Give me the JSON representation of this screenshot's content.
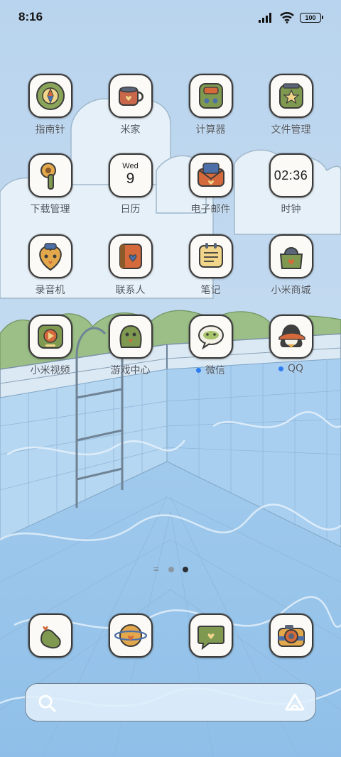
{
  "status_bar": {
    "time": "8:16",
    "battery": "100",
    "icons": [
      "signal-icon",
      "wifi-icon",
      "battery-icon"
    ]
  },
  "apps": [
    {
      "label": "指南针",
      "icon": "compass-icon"
    },
    {
      "label": "米家",
      "icon": "mijia-icon"
    },
    {
      "label": "计算器",
      "icon": "calculator-icon"
    },
    {
      "label": "文件管理",
      "icon": "file-manager-icon"
    },
    {
      "label": "下载管理",
      "icon": "download-icon"
    },
    {
      "label": "日历",
      "icon": "calendar-icon",
      "weekday": "Wed",
      "day": "9"
    },
    {
      "label": "电子邮件",
      "icon": "email-icon"
    },
    {
      "label": "时钟",
      "icon": "clock-icon",
      "time": "02:36"
    },
    {
      "label": "录音机",
      "icon": "recorder-icon"
    },
    {
      "label": "联系人",
      "icon": "contacts-icon"
    },
    {
      "label": "笔记",
      "icon": "notes-icon"
    },
    {
      "label": "小米商城",
      "icon": "mi-store-icon"
    },
    {
      "label": "小米视频",
      "icon": "mi-video-icon"
    },
    {
      "label": "游戏中心",
      "icon": "game-center-icon"
    },
    {
      "label": "微信",
      "icon": "wechat-icon",
      "new_dot": true
    },
    {
      "label": "QQ",
      "icon": "qq-icon",
      "new_dot": true
    }
  ],
  "dock": [
    {
      "icon": "phone-icon"
    },
    {
      "icon": "browser-icon"
    },
    {
      "icon": "messages-icon"
    },
    {
      "icon": "camera-icon"
    }
  ],
  "pager": {
    "pages": 2,
    "active": 2
  },
  "colors": {
    "sky": "#bcd8f0",
    "water": "#9cc7ec",
    "dot": "#2f7df2",
    "label": "#4c5560"
  }
}
